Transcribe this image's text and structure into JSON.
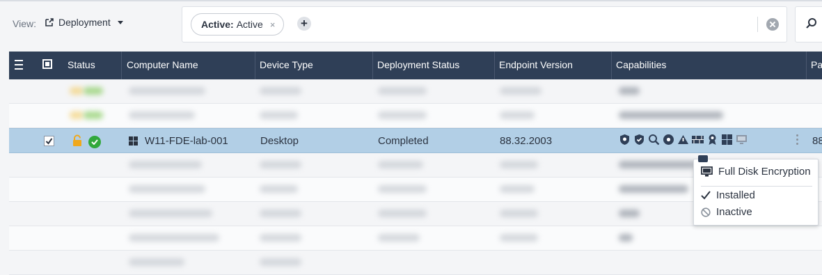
{
  "toolbar": {
    "view_label": "View:",
    "view_value": "Deployment",
    "filter_chip": {
      "key": "Active:",
      "value": "Active",
      "remove": "×"
    },
    "add_filter": "+"
  },
  "table": {
    "columns": [
      "Status",
      "Computer Name",
      "Device Type",
      "Deployment Status",
      "Endpoint Version",
      "Capabilities",
      "Pa"
    ],
    "selected_row": {
      "computer_name": "W11-FDE-lab-001",
      "device_type": "Desktop",
      "deployment_status": "Completed",
      "endpoint_version": "88.32.2003",
      "extra": "88"
    }
  },
  "popup": {
    "title": "Full Disk Encryption",
    "installed": "Installed",
    "inactive": "Inactive"
  },
  "colors": {
    "header_bg": "#2f3f57",
    "selected_row": "#b2cfe6",
    "status_ok": "#32a83c",
    "lock": "#f0a81c"
  }
}
